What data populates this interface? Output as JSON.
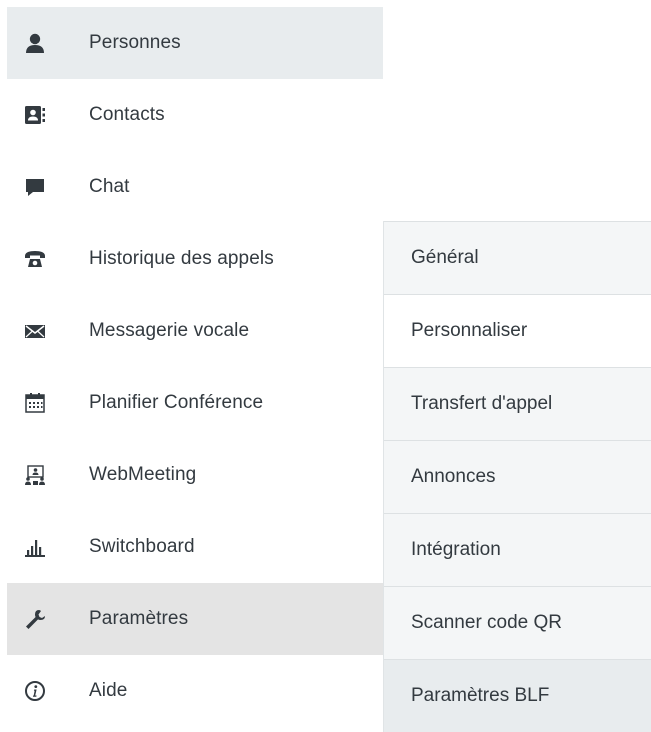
{
  "sidebar": {
    "items": [
      {
        "label": "Personnes",
        "icon": "person-icon"
      },
      {
        "label": "Contacts",
        "icon": "address-book-icon"
      },
      {
        "label": "Chat",
        "icon": "chat-bubble-icon"
      },
      {
        "label": "Historique des appels",
        "icon": "telephone-icon"
      },
      {
        "label": "Messagerie vocale",
        "icon": "envelope-icon"
      },
      {
        "label": "Planifier Conférence",
        "icon": "calendar-icon"
      },
      {
        "label": "WebMeeting",
        "icon": "webmeeting-icon"
      },
      {
        "label": "Switchboard",
        "icon": "bar-chart-icon"
      },
      {
        "label": "Paramètres",
        "icon": "wrench-icon"
      },
      {
        "label": "Aide",
        "icon": "info-icon"
      }
    ]
  },
  "submenu": {
    "items": [
      {
        "label": "Général"
      },
      {
        "label": "Personnaliser"
      },
      {
        "label": "Transfert d'appel"
      },
      {
        "label": "Annonces"
      },
      {
        "label": "Intégration"
      },
      {
        "label": "Scanner code QR"
      },
      {
        "label": "Paramètres BLF"
      }
    ]
  },
  "colors": {
    "icon": "#333a40",
    "text": "#333a40",
    "hover_bg": "#e8ecee",
    "selected_bg": "#e4e4e4",
    "submenu_bg": "#f4f6f7"
  }
}
